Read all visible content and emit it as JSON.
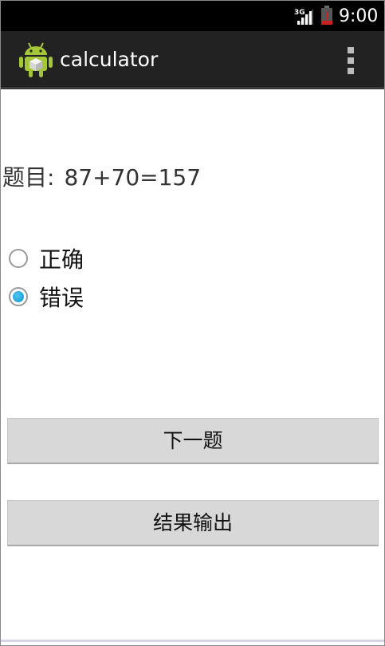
{
  "status_bar": {
    "network": "3G",
    "time": "9:00"
  },
  "action_bar": {
    "title": "calculator",
    "icons": {
      "app": "android-robot-icon",
      "menu": "overflow-menu-icon"
    }
  },
  "question": {
    "label": "题目:",
    "expression": "87+70=157"
  },
  "options": [
    {
      "label": "正确",
      "checked": false
    },
    {
      "label": "错误",
      "checked": true
    }
  ],
  "buttons": {
    "next": "下一题",
    "output": "结果输出"
  },
  "colors": {
    "status_bar": "#000000",
    "action_bar": "#222222",
    "radio_accent": "#1a9ad6",
    "button_bg": "#d8d8d8"
  }
}
